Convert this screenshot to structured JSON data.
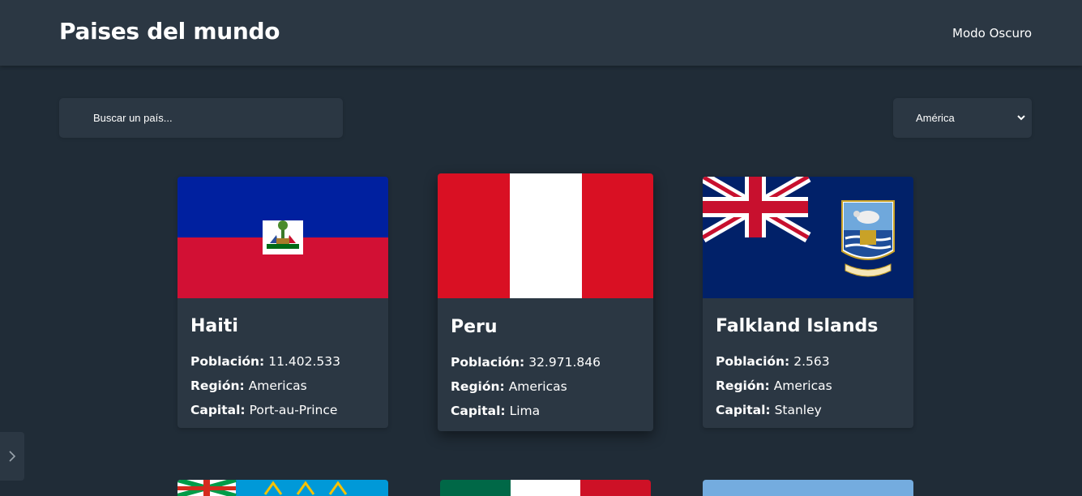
{
  "header": {
    "title": "Paises del mundo",
    "theme_toggle": "Modo Oscuro"
  },
  "search": {
    "placeholder": "Buscar un país..."
  },
  "filter": {
    "selected": "América"
  },
  "labels": {
    "population": "Población:",
    "region": "Región:",
    "capital": "Capital:"
  },
  "countries": [
    {
      "name": "Haiti",
      "population": "11.402.533",
      "region": "Americas",
      "capital": "Port-au-Prince"
    },
    {
      "name": "Peru",
      "population": "32.971.846",
      "region": "Americas",
      "capital": "Lima"
    },
    {
      "name": "Falkland Islands",
      "population": "2.563",
      "region": "Americas",
      "capital": "Stanley"
    }
  ],
  "icons": {
    "side_tab": "chevron-right-icon",
    "select": "chevron-down-icon"
  },
  "colors": {
    "background": "#202c37",
    "surface": "#2b3743",
    "text": "#ffffff"
  }
}
